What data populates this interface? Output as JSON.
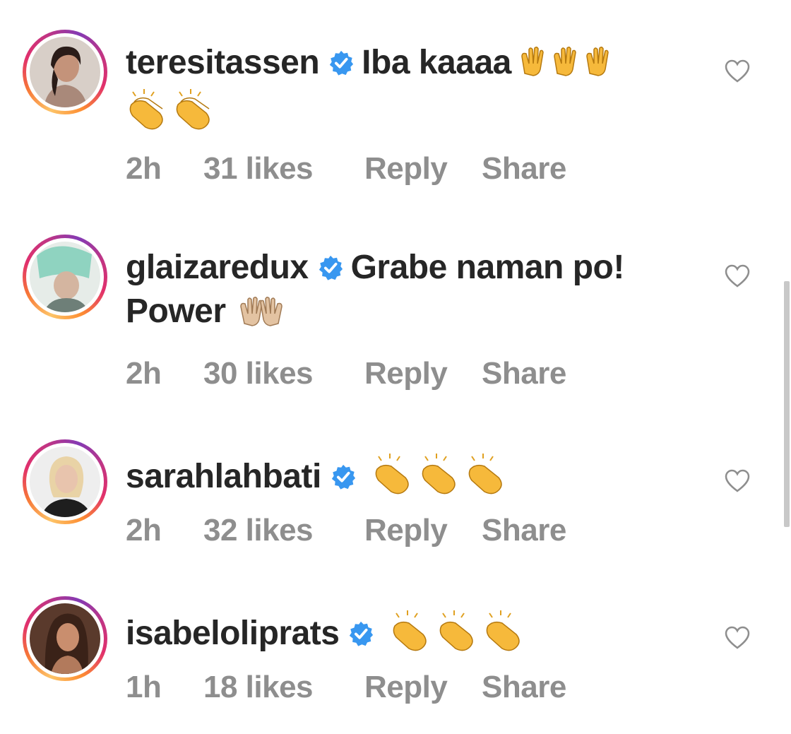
{
  "comments": [
    {
      "username": "teresitassen",
      "message": "Iba kaaaa",
      "emoji_trail": [
        "raising-hands",
        "raising-hands",
        "raising-hands"
      ],
      "emoji_line2": [
        "clapping-hands",
        "clapping-hands"
      ],
      "time": "2h",
      "likes": "31 likes",
      "reply": "Reply",
      "share": "Share"
    },
    {
      "username": "glaizaredux",
      "message": "Grabe naman po!",
      "message_line2": "Power",
      "emoji_line2": [
        "raising-hands"
      ],
      "time": "2h",
      "likes": "30 likes",
      "reply": "Reply",
      "share": "Share"
    },
    {
      "username": "sarahlahbati",
      "message": "",
      "emoji_trail": [
        "clapping-hands",
        "clapping-hands",
        "clapping-hands"
      ],
      "time": "2h",
      "likes": "32 likes",
      "reply": "Reply",
      "share": "Share"
    },
    {
      "username": "isabeloliprats",
      "message": "",
      "emoji_trail": [
        "clapping-hands",
        "clapping-hands",
        "clapping-hands"
      ],
      "time": "1h",
      "likes": "18 likes",
      "reply": "Reply",
      "share": "Share"
    }
  ],
  "icons": {
    "verified": "verified-badge-icon",
    "like": "heart-outline-icon"
  },
  "colors": {
    "verified": "#3897f0",
    "meta_text": "#8e8e8e",
    "primary_text": "#262626"
  }
}
